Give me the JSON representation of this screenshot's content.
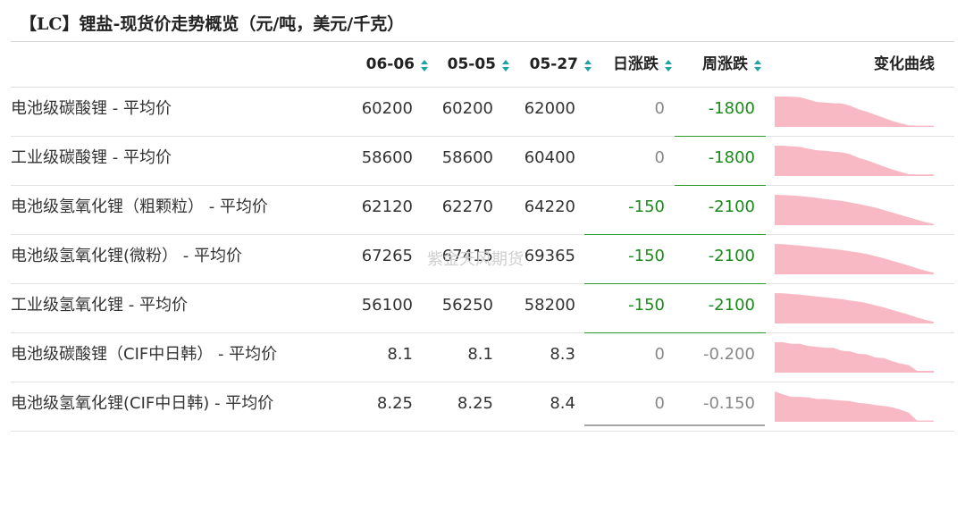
{
  "title": "【LC】锂盐-现货价走势概览（元/吨，美元/千克）",
  "columns": {
    "d1": "06-06",
    "d2": "05-05",
    "d3": "05-27",
    "daily": "日涨跌",
    "weekly": "周涨跌",
    "trend": "变化曲线"
  },
  "rows": [
    {
      "name": "电池级碳酸锂 - 平均价",
      "d1": "60200",
      "d2": "60200",
      "d3": "62000",
      "daily": "0",
      "weekly": "-1800",
      "spark": [
        1.0,
        1.0,
        0.99,
        0.98,
        0.9,
        0.82,
        0.8,
        0.78,
        0.77,
        0.7,
        0.58,
        0.5,
        0.4,
        0.3,
        0.2,
        0.12,
        0.05,
        0.04,
        0.04,
        0.04
      ]
    },
    {
      "name": "工业级碳酸锂 - 平均价",
      "d1": "58600",
      "d2": "58600",
      "d3": "60400",
      "daily": "0",
      "weekly": "-1800",
      "spark": [
        1.0,
        1.0,
        0.98,
        0.96,
        0.9,
        0.85,
        0.83,
        0.8,
        0.78,
        0.72,
        0.6,
        0.52,
        0.42,
        0.32,
        0.22,
        0.14,
        0.06,
        0.05,
        0.05,
        0.05
      ]
    },
    {
      "name": "电池级氢氧化锂（粗颗粒） - 平均价",
      "d1": "62120",
      "d2": "62270",
      "d3": "64220",
      "daily": "-150",
      "weekly": "-2100",
      "spark": [
        1.0,
        0.99,
        0.98,
        0.96,
        0.93,
        0.9,
        0.86,
        0.83,
        0.8,
        0.75,
        0.7,
        0.64,
        0.58,
        0.5,
        0.42,
        0.34,
        0.26,
        0.18,
        0.1,
        0.04
      ]
    },
    {
      "name": "电池级氢氧化锂(微粉） - 平均价",
      "d1": "67265",
      "d2": "67415",
      "d3": "69365",
      "daily": "-150",
      "weekly": "-2100",
      "spark": [
        1.0,
        0.99,
        0.97,
        0.95,
        0.92,
        0.89,
        0.86,
        0.83,
        0.8,
        0.76,
        0.72,
        0.67,
        0.6,
        0.53,
        0.45,
        0.37,
        0.29,
        0.2,
        0.12,
        0.05
      ]
    },
    {
      "name": "工业级氢氧化锂 - 平均价",
      "d1": "56100",
      "d2": "56250",
      "d3": "58200",
      "daily": "-150",
      "weekly": "-2100",
      "spark": [
        1.0,
        0.99,
        0.97,
        0.95,
        0.92,
        0.89,
        0.86,
        0.83,
        0.8,
        0.76,
        0.72,
        0.67,
        0.6,
        0.53,
        0.45,
        0.37,
        0.29,
        0.2,
        0.12,
        0.05
      ]
    },
    {
      "name": "电池级碳酸锂（CIF中日韩） - 平均价",
      "d1": "8.1",
      "d2": "8.1",
      "d3": "8.3",
      "daily": "0",
      "weekly": "-0.200",
      "spark": [
        1.0,
        1.0,
        0.95,
        0.95,
        0.88,
        0.85,
        0.82,
        0.82,
        0.72,
        0.7,
        0.62,
        0.6,
        0.5,
        0.48,
        0.38,
        0.3,
        0.25,
        0.06,
        0.06,
        0.06
      ]
    },
    {
      "name": "电池级氢氧化锂(CIF中日韩) - 平均价",
      "d1": "8.25",
      "d2": "8.25",
      "d3": "8.4",
      "daily": "0",
      "weekly": "-0.150",
      "spark": [
        1.0,
        0.9,
        0.82,
        0.82,
        0.8,
        0.75,
        0.75,
        0.72,
        0.7,
        0.68,
        0.62,
        0.6,
        0.55,
        0.52,
        0.48,
        0.4,
        0.3,
        0.04,
        0.04,
        0.04
      ]
    }
  ],
  "watermark": "紫金天风期货",
  "colors": {
    "positive_neutral": "#888888",
    "negative": "#1a8a1a",
    "spark_fill": "#f9b9c4",
    "sort_icon": "#1aa3a3"
  }
}
